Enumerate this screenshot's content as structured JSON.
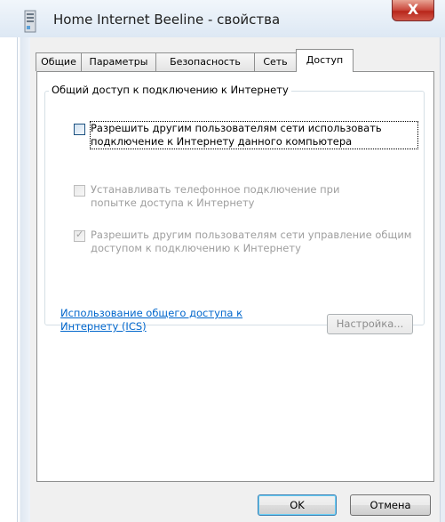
{
  "window": {
    "title": "Home Internet Beeline - свойства",
    "close_glyph": "X"
  },
  "tabs": [
    {
      "label": "Общие",
      "active": false
    },
    {
      "label": "Параметры",
      "active": false
    },
    {
      "label": "Безопасность",
      "active": false
    },
    {
      "label": "Сеть",
      "active": false
    },
    {
      "label": "Доступ",
      "active": true
    }
  ],
  "sharing": {
    "group_title": "Общий доступ к подключению к Интернету",
    "allow_sharing": {
      "label": "Разрешить другим пользователям сети использовать подключение к Интернету данного компьютера",
      "checked": false,
      "enabled": true
    },
    "dial_on_demand": {
      "label": "Устанавливать телефонное подключение при попытке доступа к Интернету",
      "checked": false,
      "enabled": false
    },
    "allow_control": {
      "label": "Разрешить другим пользователям сети управление общим доступом к подключению к Интернету",
      "checked": true,
      "enabled": false
    },
    "ics_link": "Использование общего доступа к Интернету (ICS)",
    "settings_button": "Настройка..."
  },
  "buttons": {
    "ok": "OK",
    "cancel": "Отмена"
  },
  "colors": {
    "link": "#0066cc",
    "close_button": "#c9463a"
  },
  "icons": {
    "title": "network-connection-icon",
    "close": "close-icon",
    "check": "checkmark-icon"
  }
}
